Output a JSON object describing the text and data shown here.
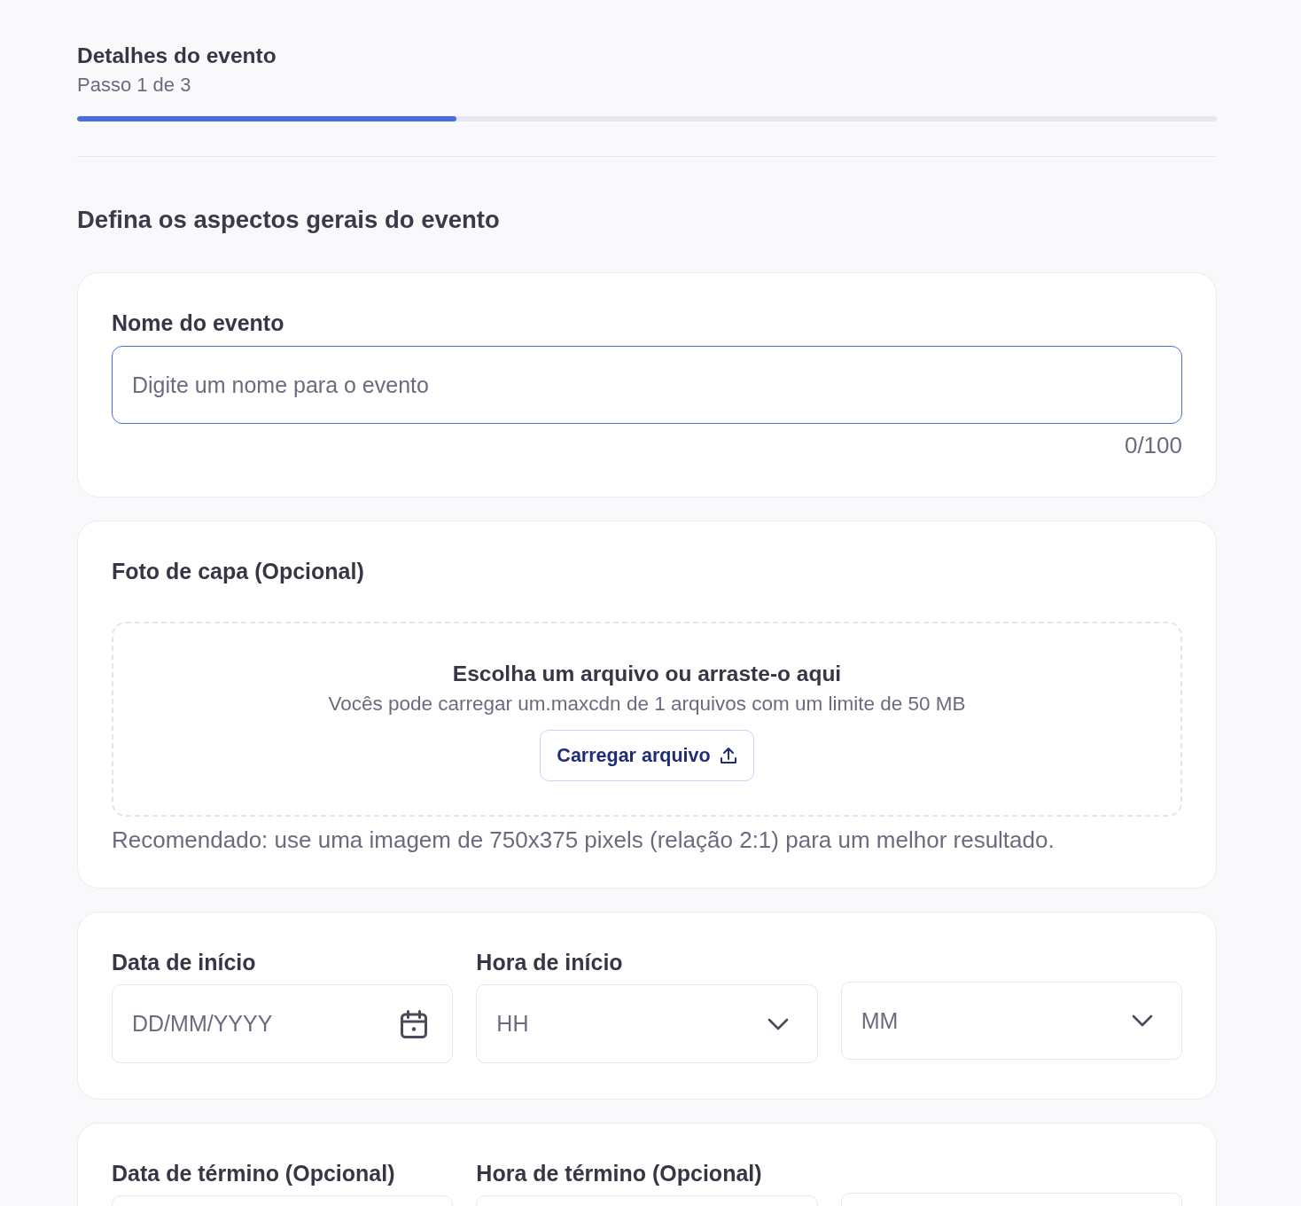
{
  "header": {
    "title": "Detalhes do evento",
    "step": "Passo 1 de 3",
    "progress": {
      "level": 0.333
    }
  },
  "section_title": "Defina os aspectos gerais do evento",
  "name_card": {
    "label": "Nome do evento",
    "field": {
      "placeholder": "Digite um nome para o evento",
      "focused": true
    },
    "counter": "0/100"
  },
  "cover_card": {
    "label": "Foto de capa (Opcional)",
    "dropzone": {
      "title": "Escolha um arquivo ou arraste-o aqui",
      "subtitle": "Vocês pode carregar um.maxcdn de 1 arquivos com um limite de 50 MB",
      "button": "Carregar arquivo"
    },
    "hint": "Recomendado: use uma imagem de 750x375 pixels (relação 2:1) para um melhor resultado."
  },
  "datetime_cards": [
    {
      "date_label": "Data de início",
      "time_label": "Hora de início",
      "fields": [
        {
          "kind": "date",
          "placeholder": "DD/MM/YYYY"
        },
        {
          "kind": "select",
          "placeholder": "HH"
        },
        {
          "kind": "select",
          "placeholder": "MM"
        }
      ]
    },
    {
      "date_label": "Data de término (Opcional)",
      "time_label": "Hora de término (Opcional)",
      "fields": [
        {
          "kind": "date"
        },
        {
          "kind": "select"
        },
        {
          "kind": "select"
        }
      ]
    }
  ]
}
